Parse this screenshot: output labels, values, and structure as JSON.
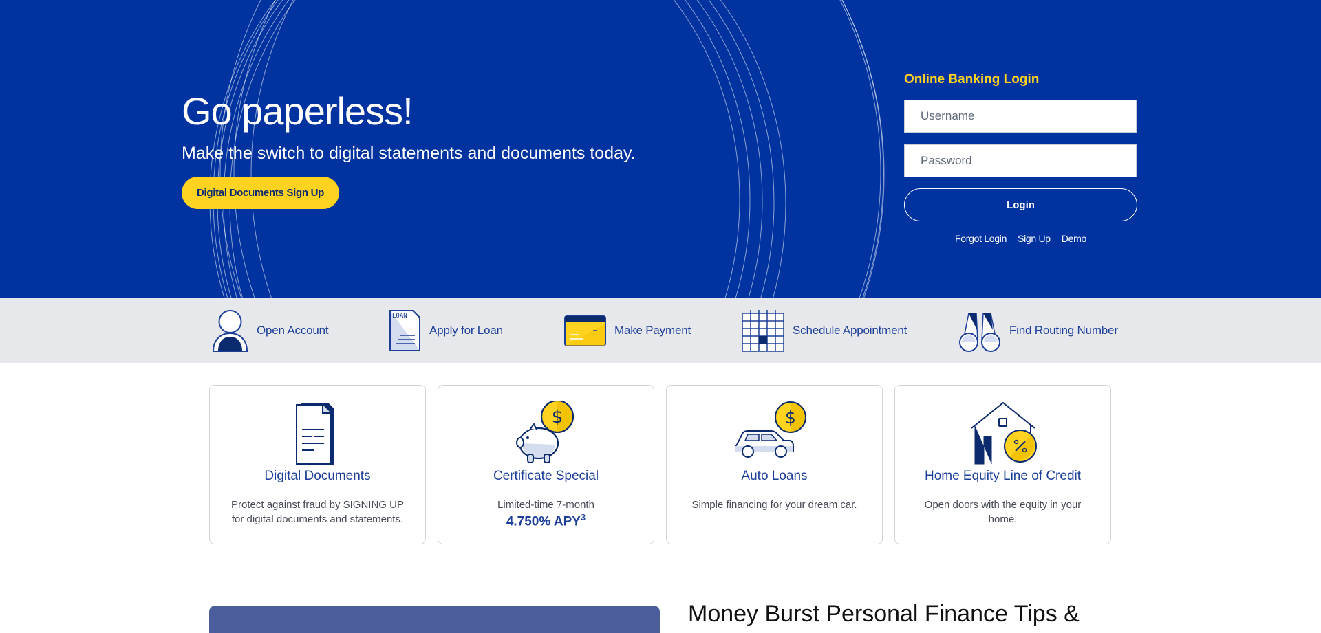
{
  "hero": {
    "title": "Go paperless!",
    "subtitle": "Make the switch to digital statements and documents today.",
    "cta_label": "Digital Documents Sign Up"
  },
  "login": {
    "title": "Online Banking Login",
    "username_placeholder": "Username",
    "password_placeholder": "Password",
    "login_label": "Login",
    "links": [
      "Forgot Login",
      "Sign Up",
      "Demo"
    ]
  },
  "quick_actions": [
    {
      "label": "Open Account",
      "icon": "person-icon"
    },
    {
      "label": "Apply for Loan",
      "icon": "loan-document-icon",
      "icon_text": "LOAN"
    },
    {
      "label": "Make Payment",
      "icon": "credit-card-icon"
    },
    {
      "label": "Schedule Appointment",
      "icon": "calendar-icon"
    },
    {
      "label": "Find Routing Number",
      "icon": "binoculars-icon"
    }
  ],
  "cards": [
    {
      "title": "Digital Documents",
      "text": "Protect against fraud by SIGNING UP for digital documents and statements.",
      "icon": "document-icon"
    },
    {
      "title": "Certificate Special",
      "text": "Limited-time 7-month",
      "rate": "4.750% APY",
      "rate_footnote": "3",
      "icon": "piggy-bank-coin-icon"
    },
    {
      "title": "Auto Loans",
      "text": "Simple financing for your dream car.",
      "icon": "car-coin-icon"
    },
    {
      "title": "Home Equity Line of Credit",
      "text": "Open doors with the equity in your home.",
      "icon": "house-percent-icon"
    }
  ],
  "blog": {
    "title": "Money Burst Personal Finance Tips &"
  },
  "colors": {
    "hero_blue": "#0033a0",
    "accent_yellow": "#ffd320",
    "link_blue": "#1d3f99",
    "quick_bar_gray": "#e6e8eb"
  }
}
